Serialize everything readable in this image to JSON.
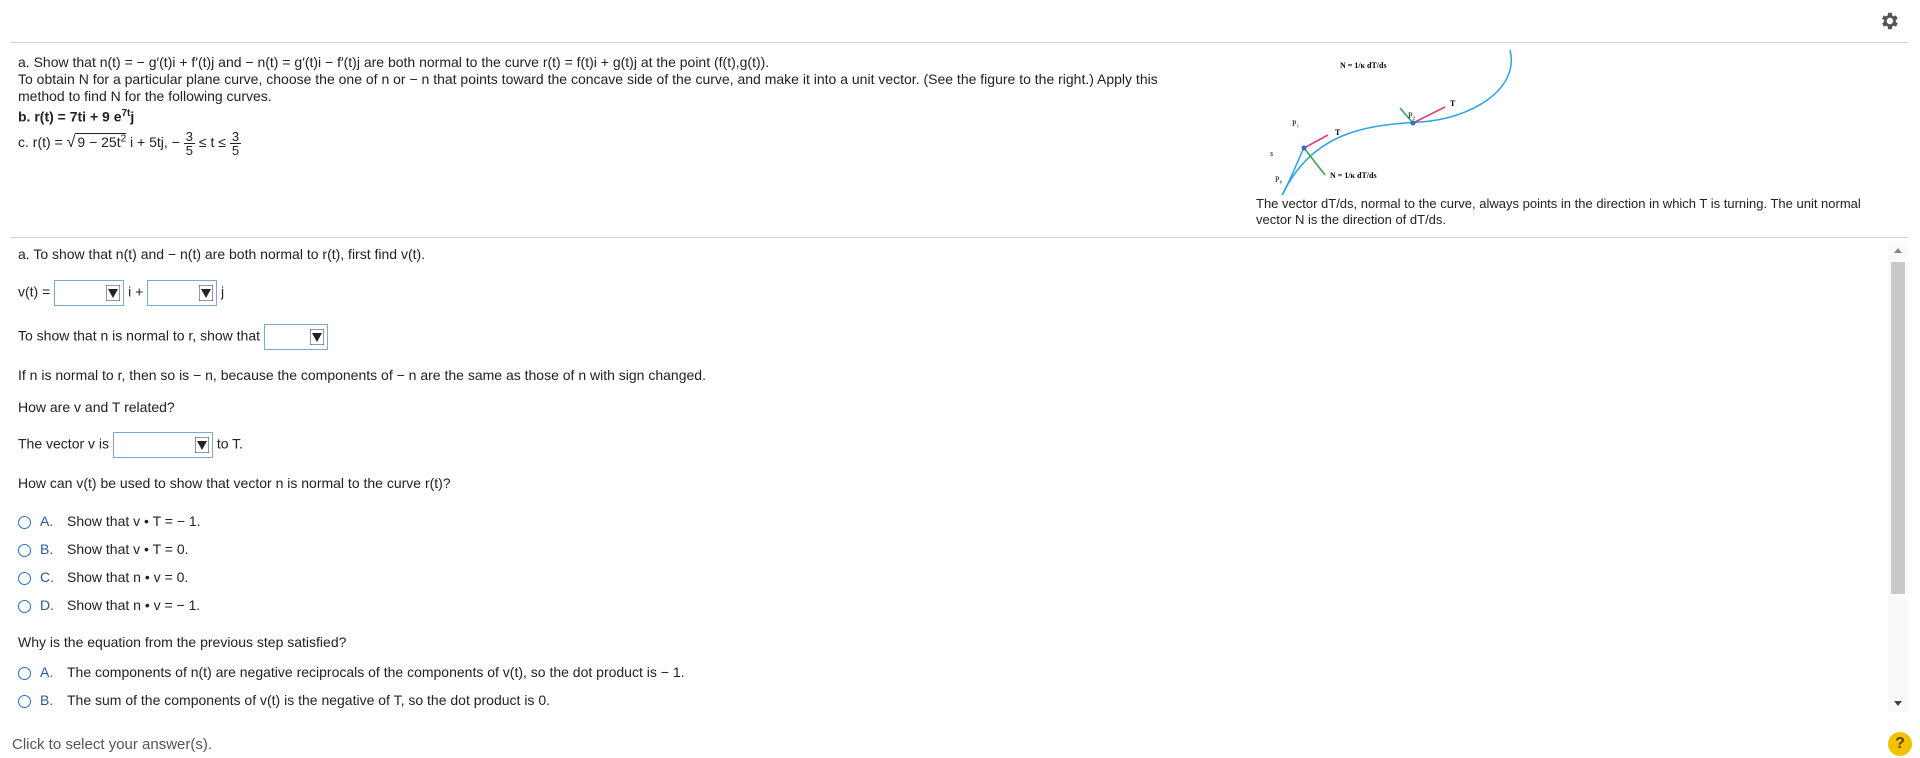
{
  "problem": {
    "line1": "a. Show that n(t) = − g′(t)i + f′(t)j and − n(t) = g′(t)i − f′(t)j are both normal to the curve r(t) = f(t)i + g(t)j at the point (f(t),g(t)).",
    "line2": "To obtain N for a particular plane curve, choose the one of n or − n that points toward the concave side of the curve, and make it into a unit vector. (See the figure to the right.) Apply this",
    "line3": "method to find N for the following curves.",
    "part_b": "b. r(t) = 7ti + 9 e",
    "part_b_exp": "7t",
    "part_b_tail": "j",
    "part_c_start": "c. r(t) = ",
    "part_c_sqrt": "9 − 25t",
    "part_c_sqrt_exp": "2",
    "part_c_mid": " i + 5tj,  −",
    "part_c_frac_num": "3",
    "part_c_frac_den": "5",
    "part_c_leq": "≤ t ≤",
    "part_c_frac2_num": "3",
    "part_c_frac2_den": "5"
  },
  "figure": {
    "caption1": "The vector dT/ds, normal to the curve, always points in the direction in which T is turning. The unit normal",
    "caption2": "vector N is the direction of dT/ds.",
    "label_n_top": "N = 1/κ dT/ds",
    "label_n_bottom": "N = 1/κ dT/ds",
    "label_t1": "T",
    "label_t2": "T",
    "label_p0": "P₀",
    "label_p1": "P₁",
    "label_p2": "P₂",
    "label_s": "s"
  },
  "answer": {
    "intro": "a. To show that n(t) and − n(t) are both normal to r(t), first find v(t).",
    "v_label": "v(t) =",
    "i_label": "i +",
    "j_label": "j",
    "normal_prompt": "To show that n is normal to r, show that",
    "neg_n_text": "If n is normal to r, then so is − n, because the components of − n are the same as those of n with sign changed.",
    "vt_question": "How are v and T related?",
    "vector_v_is": "The vector v is",
    "to_t": "to T.",
    "q1": "How can v(t) be used to show that vector n is normal to the curve r(t)?",
    "q1_options": [
      {
        "letter": "A.",
        "text": "Show that v • T = − 1."
      },
      {
        "letter": "B.",
        "text": "Show that v • T = 0."
      },
      {
        "letter": "C.",
        "text": "Show that n • v = 0."
      },
      {
        "letter": "D.",
        "text": "Show that n • v = − 1."
      }
    ],
    "q2": "Why is the equation from the previous step satisfied?",
    "q2_options": [
      {
        "letter": "A.",
        "text": "The components of n(t) are negative reciprocals of the components of v(t), so the dot product is − 1."
      },
      {
        "letter": "B.",
        "text": "The sum of the components of v(t) is the negative of T, so the dot product is 0."
      }
    ]
  },
  "footer": {
    "hint": "Click to select your answer(s).",
    "help": "?"
  },
  "colors": {
    "radio": "#2a6ec5",
    "dropdown_border": "#7aa7d6",
    "scroll_thumb": "#c9c9c9",
    "help_bg": "#f2c200"
  }
}
